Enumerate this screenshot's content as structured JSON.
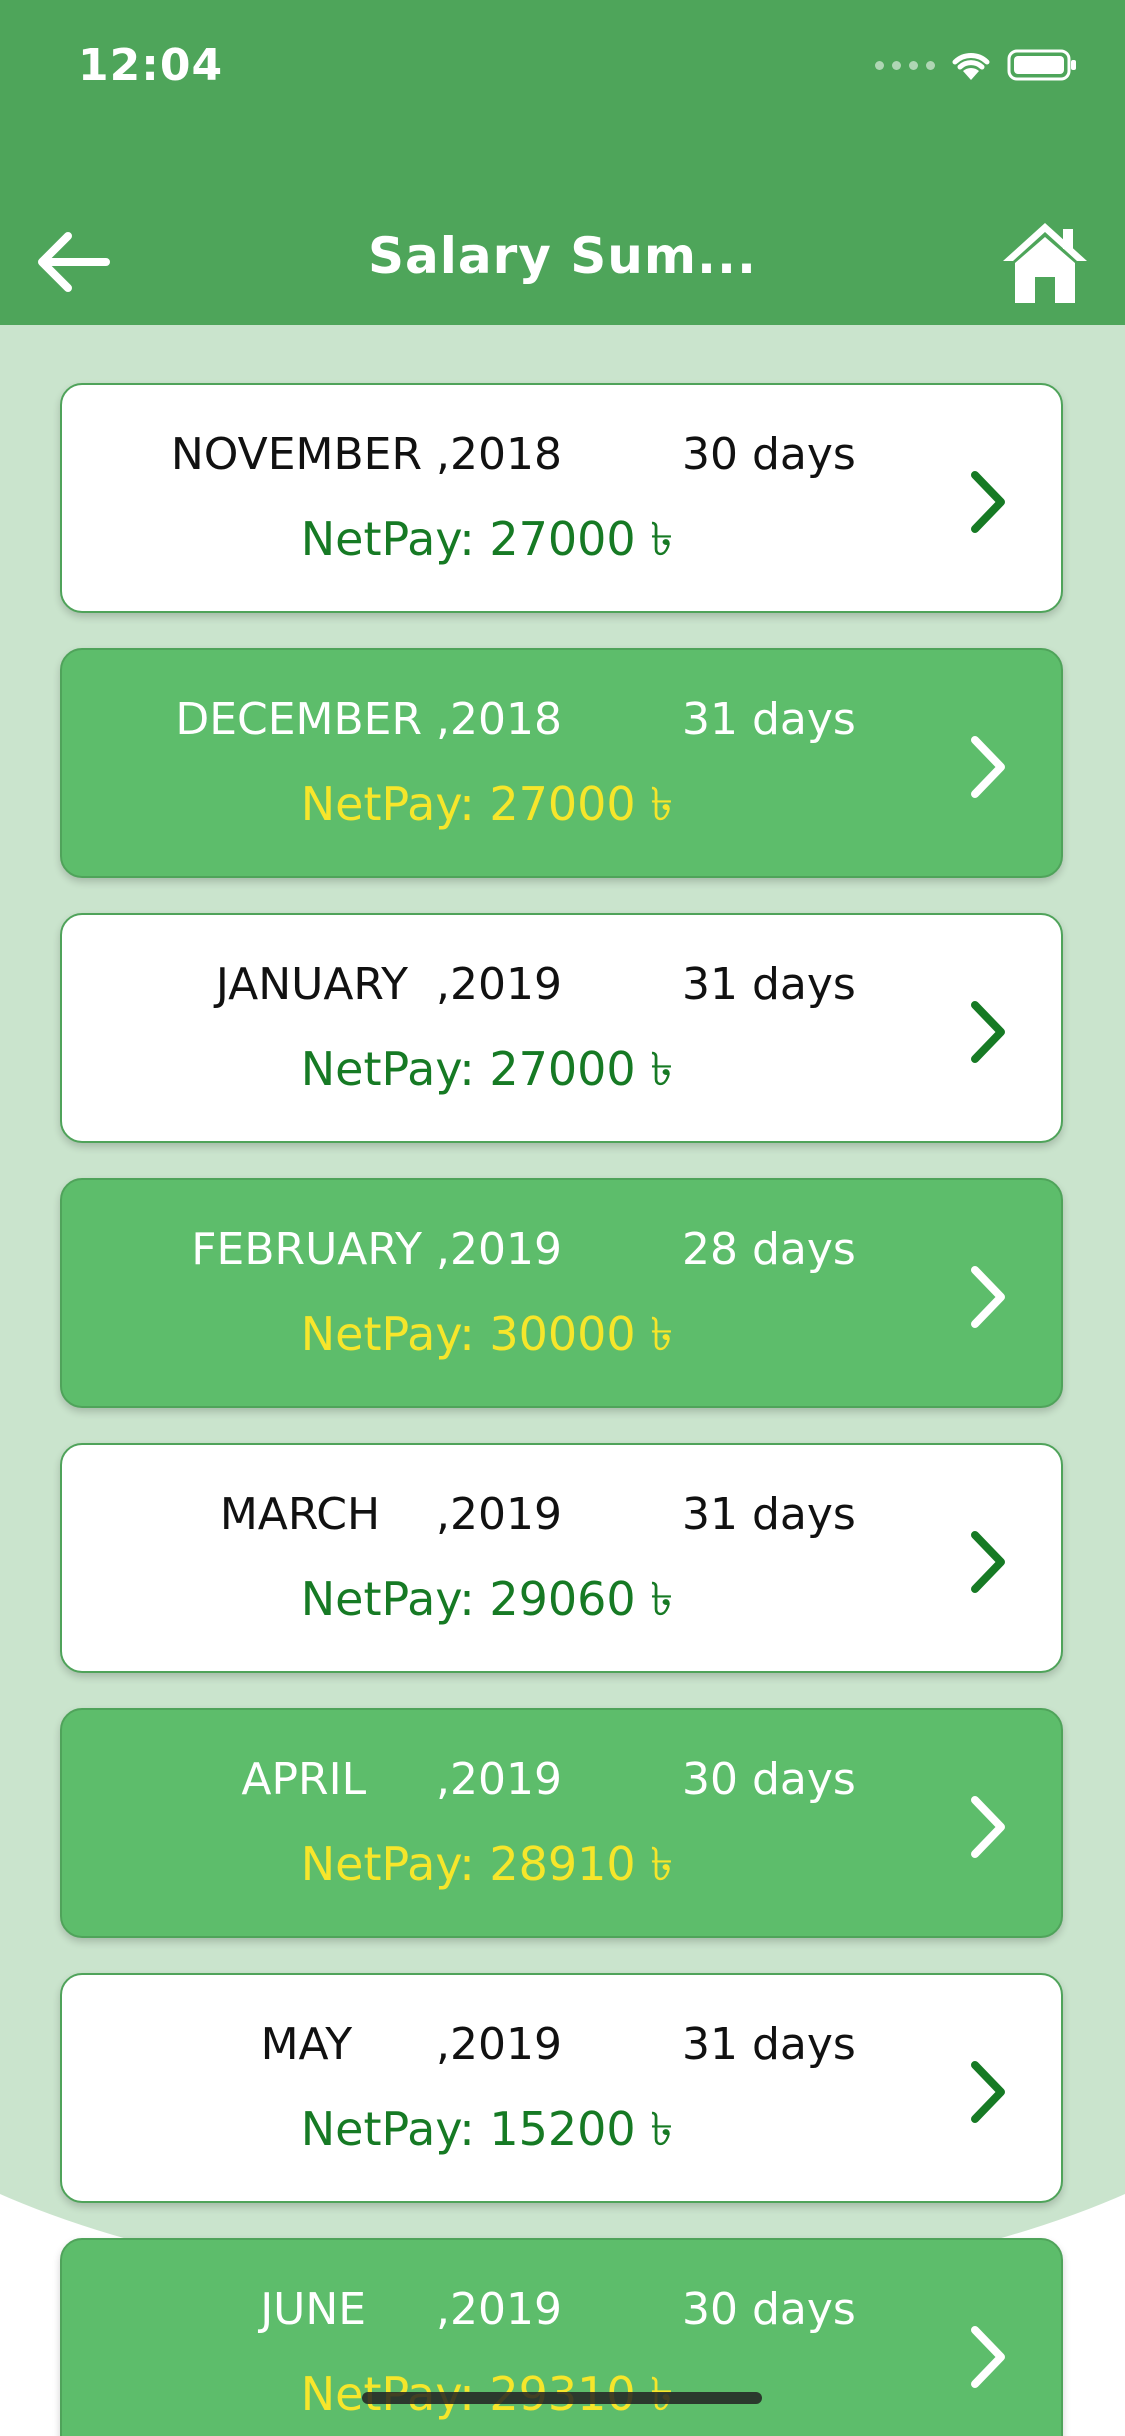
{
  "status": {
    "time": "12:04"
  },
  "nav": {
    "title": "Salary Sum..."
  },
  "colors": {
    "brand": "#4ea55a",
    "card_green": "#5dbd6b",
    "netpay_green": "#167a24",
    "netpay_yellow": "#f6e62b"
  },
  "items": [
    {
      "month": "NOVEMBER ,2018",
      "days": "30 days",
      "netpay": "NetPay: 27000 ৳",
      "style": "white"
    },
    {
      "month": "DECEMBER ,2018",
      "days": "31 days",
      "netpay": "NetPay: 27000 ৳",
      "style": "green"
    },
    {
      "month": "JANUARY  ,2019",
      "days": "31 days",
      "netpay": "NetPay: 27000 ৳",
      "style": "white"
    },
    {
      "month": "FEBRUARY ,2019",
      "days": "28 days",
      "netpay": "NetPay: 30000 ৳",
      "style": "green"
    },
    {
      "month": "MARCH    ,2019",
      "days": "31 days",
      "netpay": "NetPay: 29060 ৳",
      "style": "white"
    },
    {
      "month": "APRIL     ,2019",
      "days": "30 days",
      "netpay": "NetPay: 28910 ৳",
      "style": "green"
    },
    {
      "month": "MAY      ,2019",
      "days": "31 days",
      "netpay": "NetPay: 15200 ৳",
      "style": "white"
    },
    {
      "month": "JUNE     ,2019",
      "days": "30 days",
      "netpay": "NetPay: 29310 ৳",
      "style": "green"
    }
  ]
}
